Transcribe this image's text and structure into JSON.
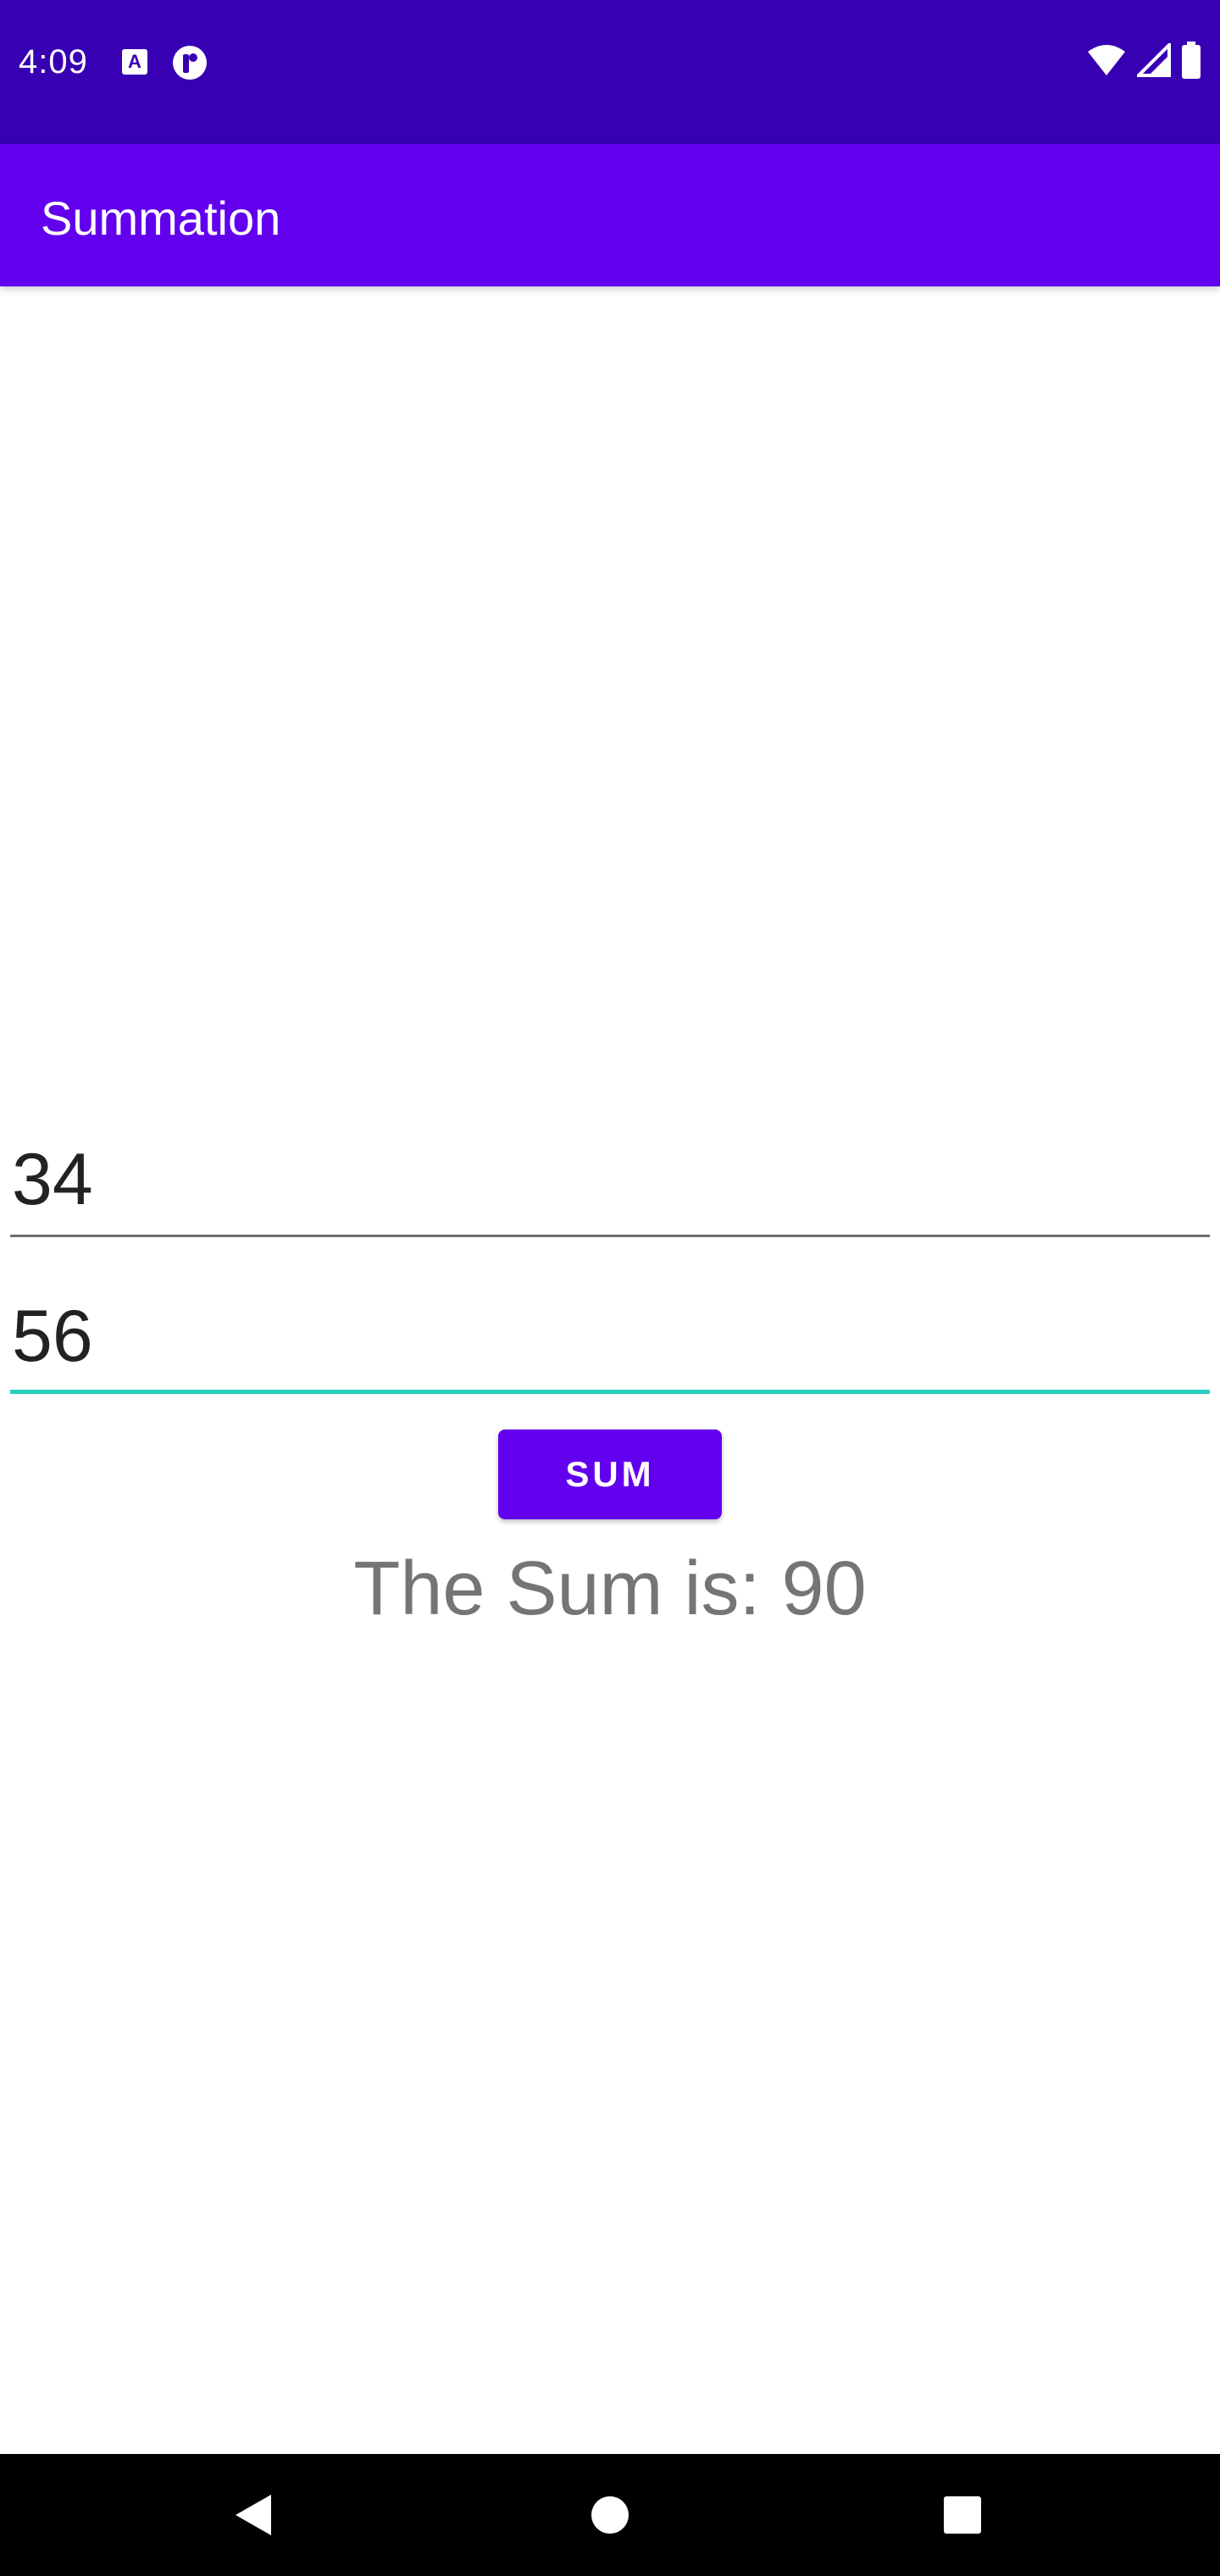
{
  "status_bar": {
    "time": "4:09",
    "notification_icons": [
      "a-badge-icon",
      "circle-p-icon"
    ],
    "system_icons": [
      "wifi-icon",
      "signal-icon",
      "battery-icon"
    ],
    "background": "#3700B3"
  },
  "app_bar": {
    "title": "Summation",
    "background": "#6200EE"
  },
  "form": {
    "first_number": "34",
    "second_number": "56",
    "focus_accent": "#26CFC0",
    "sum_button_label": "SUM",
    "result_text": "The Sum is: 90"
  },
  "nav_bar": {
    "buttons": [
      "back-icon",
      "home-icon",
      "recents-icon"
    ]
  }
}
